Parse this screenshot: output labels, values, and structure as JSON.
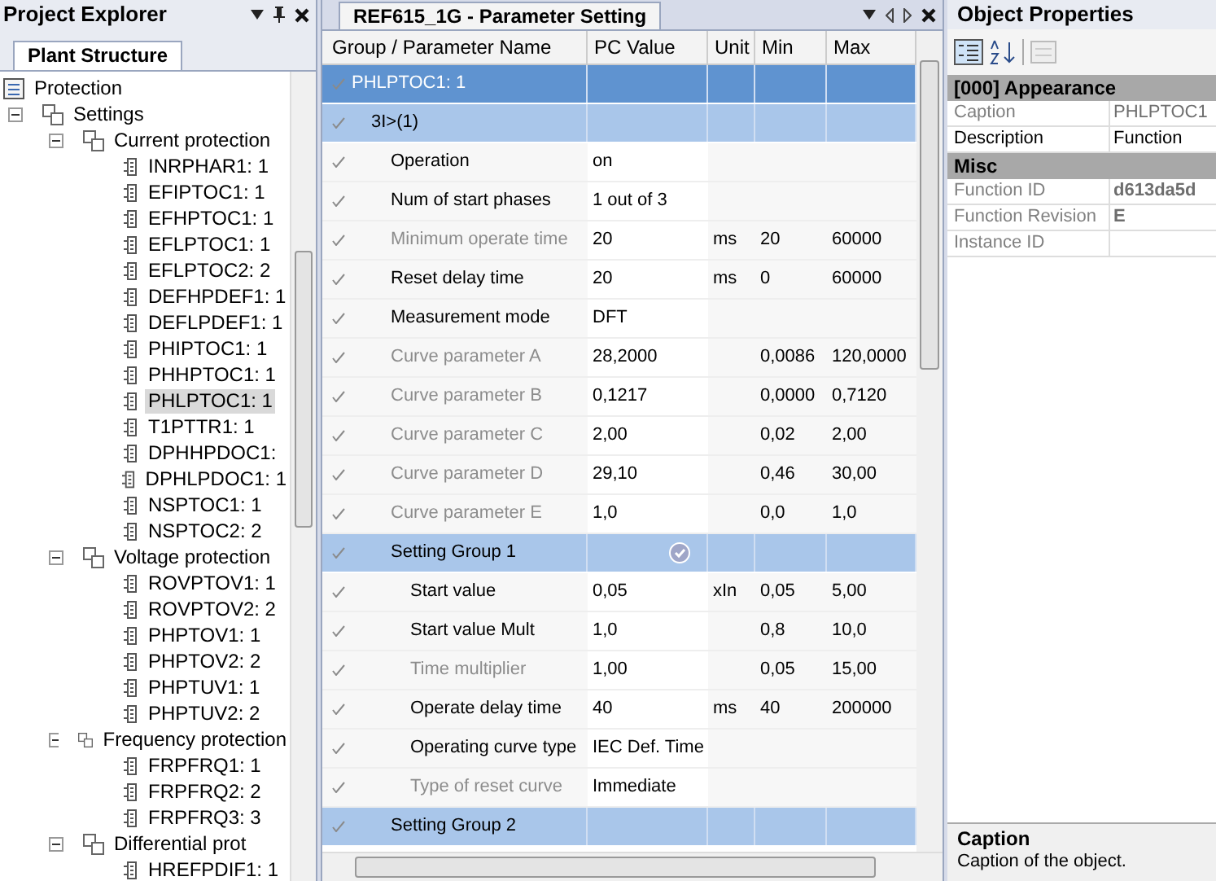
{
  "project_explorer": {
    "title": "Project Explorer",
    "tab": "Plant Structure",
    "tree": [
      {
        "label": "Protection",
        "kind": "root",
        "children": [
          {
            "label": "Settings",
            "kind": "group",
            "expanded": true,
            "children": [
              {
                "label": "Current protection",
                "kind": "group",
                "expanded": true,
                "children": [
                  {
                    "label": "INRPHAR1: 1",
                    "kind": "function",
                    "selected": false
                  },
                  {
                    "label": "EFIPTOC1: 1",
                    "kind": "function",
                    "selected": false
                  },
                  {
                    "label": "EFHPTOC1: 1",
                    "kind": "function",
                    "selected": false
                  },
                  {
                    "label": "EFLPTOC1: 1",
                    "kind": "function",
                    "selected": false
                  },
                  {
                    "label": "EFLPTOC2: 2",
                    "kind": "function",
                    "selected": false
                  },
                  {
                    "label": "DEFHPDEF1: 1",
                    "kind": "function",
                    "selected": false
                  },
                  {
                    "label": "DEFLPDEF1: 1",
                    "kind": "function",
                    "selected": false
                  },
                  {
                    "label": "PHIPTOC1: 1",
                    "kind": "function",
                    "selected": false
                  },
                  {
                    "label": "PHHPTOC1: 1",
                    "kind": "function",
                    "selected": false
                  },
                  {
                    "label": "PHLPTOC1: 1",
                    "kind": "function",
                    "selected": true
                  },
                  {
                    "label": "T1PTTR1: 1",
                    "kind": "function",
                    "selected": false
                  },
                  {
                    "label": "DPHHPDOC1:",
                    "kind": "function",
                    "selected": false
                  },
                  {
                    "label": "DPHLPDOC1: 1",
                    "kind": "function",
                    "selected": false
                  },
                  {
                    "label": "NSPTOC1: 1",
                    "kind": "function",
                    "selected": false
                  },
                  {
                    "label": "NSPTOC2: 2",
                    "kind": "function",
                    "selected": false
                  }
                ]
              },
              {
                "label": "Voltage protection",
                "kind": "group",
                "expanded": true,
                "children": [
                  {
                    "label": "ROVPTOV1: 1",
                    "kind": "function",
                    "selected": false
                  },
                  {
                    "label": "ROVPTOV2: 2",
                    "kind": "function",
                    "selected": false
                  },
                  {
                    "label": "PHPTOV1: 1",
                    "kind": "function",
                    "selected": false
                  },
                  {
                    "label": "PHPTOV2: 2",
                    "kind": "function",
                    "selected": false
                  },
                  {
                    "label": "PHPTUV1: 1",
                    "kind": "function",
                    "selected": false
                  },
                  {
                    "label": "PHPTUV2: 2",
                    "kind": "function",
                    "selected": false
                  }
                ]
              },
              {
                "label": "Frequency protection",
                "kind": "group",
                "expanded": true,
                "children": [
                  {
                    "label": "FRPFRQ1: 1",
                    "kind": "function",
                    "selected": false
                  },
                  {
                    "label": "FRPFRQ2: 2",
                    "kind": "function",
                    "selected": false
                  },
                  {
                    "label": "FRPFRQ3: 3",
                    "kind": "function",
                    "selected": false
                  }
                ]
              },
              {
                "label": "Differential prot",
                "kind": "group",
                "expanded": true,
                "children": [
                  {
                    "label": "HREFPDIF1: 1",
                    "kind": "function",
                    "selected": false
                  }
                ]
              }
            ]
          }
        ]
      }
    ]
  },
  "parameter_setting": {
    "tab": "REF615_1G - Parameter Setting",
    "columns": [
      "Group / Parameter Name",
      "PC Value",
      "Unit",
      "Min",
      "Max"
    ],
    "rows": [
      {
        "kind": "group",
        "name": "PHLPTOC1: 1",
        "selected": true,
        "children": [
          {
            "kind": "group",
            "name": "3I>(1)",
            "selected": false,
            "children": [
              {
                "kind": "param",
                "name": "Operation",
                "value": "on",
                "disabled": false
              },
              {
                "kind": "param",
                "name": "Num of start phases",
                "value": "1 out of 3",
                "disabled": false
              },
              {
                "kind": "param",
                "name": "Minimum operate time",
                "value": "20",
                "unit": "ms",
                "min": "20",
                "max": "60000",
                "disabled": true
              },
              {
                "kind": "param",
                "name": "Reset delay time",
                "value": "20",
                "unit": "ms",
                "min": "0",
                "max": "60000",
                "disabled": false
              },
              {
                "kind": "param",
                "name": "Measurement mode",
                "value": "DFT",
                "disabled": false
              },
              {
                "kind": "param",
                "name": "Curve parameter A",
                "value": "28,2000",
                "min": "0,0086",
                "max": "120,0000",
                "disabled": true
              },
              {
                "kind": "param",
                "name": "Curve parameter B",
                "value": "0,1217",
                "min": "0,0000",
                "max": "0,7120",
                "disabled": true
              },
              {
                "kind": "param",
                "name": "Curve parameter C",
                "value": "2,00",
                "min": "0,02",
                "max": "2,00",
                "disabled": true
              },
              {
                "kind": "param",
                "name": "Curve parameter D",
                "value": "29,10",
                "min": "0,46",
                "max": "30,00",
                "disabled": true
              },
              {
                "kind": "param",
                "name": "Curve parameter E",
                "value": "1,0",
                "min": "0,0",
                "max": "1,0",
                "disabled": true
              },
              {
                "kind": "group",
                "name": "Setting Group 1",
                "selected": false,
                "active": true,
                "children": [
                  {
                    "kind": "param",
                    "name": "Start value",
                    "value": "0,05",
                    "unit": "xIn",
                    "min": "0,05",
                    "max": "5,00",
                    "disabled": false
                  },
                  {
                    "kind": "param",
                    "name": "Start value Mult",
                    "value": "1,0",
                    "min": "0,8",
                    "max": "10,0",
                    "disabled": false
                  },
                  {
                    "kind": "param",
                    "name": "Time multiplier",
                    "value": "1,00",
                    "min": "0,05",
                    "max": "15,00",
                    "disabled": true
                  },
                  {
                    "kind": "param",
                    "name": "Operate delay time",
                    "value": "40",
                    "unit": "ms",
                    "min": "40",
                    "max": "200000",
                    "disabled": false
                  },
                  {
                    "kind": "param",
                    "name": "Operating curve type",
                    "value": "IEC Def. Time",
                    "disabled": false
                  },
                  {
                    "kind": "param",
                    "name": "Type of reset curve",
                    "value": "Immediate",
                    "disabled": true
                  }
                ]
              },
              {
                "kind": "group",
                "name": "Setting Group 2",
                "selected": false,
                "active": false
              }
            ]
          }
        ]
      }
    ]
  },
  "object_properties": {
    "title": "Object Properties",
    "items": [
      {
        "kind": "category",
        "name": "[000] Appearance"
      },
      {
        "kind": "property",
        "name": "Caption",
        "value": "PHLPTOC1",
        "readonly": true
      },
      {
        "kind": "property",
        "name": "Description",
        "value": "Function",
        "readonly": false
      },
      {
        "kind": "category",
        "name": "Misc"
      },
      {
        "kind": "property",
        "name": "Function ID",
        "value": "d613da5d",
        "readonly": true,
        "bold": true
      },
      {
        "kind": "property",
        "name": "Function Revision",
        "value": "E",
        "readonly": true,
        "bold": true
      },
      {
        "kind": "property",
        "name": "Instance ID",
        "readonly": true
      }
    ],
    "description_title": "Caption",
    "description_text": "Caption of the object."
  }
}
